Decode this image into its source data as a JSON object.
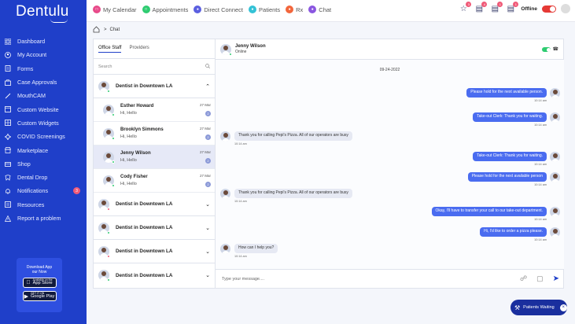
{
  "app": {
    "logo": "Dentulu"
  },
  "sidebar": {
    "items": [
      {
        "label": "Dashboard",
        "icon": "grid-icon"
      },
      {
        "label": "My Account",
        "icon": "user-circle-icon"
      },
      {
        "label": "Forms",
        "icon": "forms-icon"
      },
      {
        "label": "Case Approvals",
        "icon": "briefcase-icon"
      },
      {
        "label": "MouthCAM",
        "icon": "wand-icon"
      },
      {
        "label": "Custom Website",
        "icon": "website-icon"
      },
      {
        "label": "Custom Widgets",
        "icon": "widget-icon"
      },
      {
        "label": "COVID Screenings",
        "icon": "virus-icon"
      },
      {
        "label": "Marketplace",
        "icon": "store-icon"
      },
      {
        "label": "Shop",
        "icon": "shop-icon"
      },
      {
        "label": "Dental Drop",
        "icon": "tooth-icon"
      },
      {
        "label": "Notifications",
        "icon": "bell-icon",
        "badge": "3"
      },
      {
        "label": "Resources",
        "icon": "resources-icon"
      },
      {
        "label": "Report a problem",
        "icon": "warning-icon"
      }
    ],
    "download": {
      "text": "Download App our Now",
      "appstore_small": "Available on the",
      "appstore": "App Store",
      "googleplay_small": "GET IT ON",
      "googleplay": "Google Play"
    }
  },
  "topnav": {
    "items": [
      {
        "label": "My Calendar",
        "color": "#e84a8a"
      },
      {
        "label": "Appointments",
        "color": "#2ecc71"
      },
      {
        "label": "Direct Connect",
        "color": "#5b5fe0"
      },
      {
        "label": "Patients",
        "color": "#33c2d6"
      },
      {
        "label": "Rx",
        "color": "#f2663c"
      },
      {
        "label": "Chat",
        "color": "#8a56e0"
      }
    ],
    "badges": [
      "3",
      "4",
      "1",
      "1"
    ],
    "status": "Offline"
  },
  "breadcrumb": {
    "current": "Chat"
  },
  "chatlist": {
    "tabs": [
      "Office Staff",
      "Providers"
    ],
    "search_placeholder": "Search",
    "groups": [
      {
        "name": "Dentist in Downtown LA",
        "expanded": true
      },
      {
        "name": "Dentist in Downtown LA"
      },
      {
        "name": "Dentist in Downtown LA"
      },
      {
        "name": "Dentist in Downtown LA"
      },
      {
        "name": "Dentist in Downtown LA"
      }
    ],
    "contacts": [
      {
        "name": "Esther Howard",
        "msg": "Hi, Hello",
        "date": "27 Mar",
        "badge": "2"
      },
      {
        "name": "Brooklyn Simmons",
        "msg": "Hi, Hello",
        "date": "27 Mar",
        "badge": "2"
      },
      {
        "name": "Jenny Wilson",
        "msg": "Hi, Hello",
        "date": "27 Mar",
        "badge": "2",
        "selected": true
      },
      {
        "name": "Cody Fisher",
        "msg": "Hi, Hello",
        "date": "27 Mar",
        "badge": "2"
      }
    ]
  },
  "chat": {
    "header": {
      "name": "Jenny Wilson",
      "status": "Online"
    },
    "date": "09-24-2022",
    "messages": [
      {
        "dir": "out",
        "text": "Please hold for the next available person.",
        "time": "10:14 am"
      },
      {
        "dir": "out",
        "text": "Take-out Clerk: Thank you for waiting.",
        "time": "10:14 am"
      },
      {
        "dir": "in",
        "text": "Thank you for calling Pepi's Pizza. All of our operators are busy",
        "time": "10:14 am"
      },
      {
        "dir": "out",
        "text": "Take-out Clerk: Thank you for waiting.",
        "time": "10:14 am"
      },
      {
        "dir": "out",
        "text": "Please hold for the next available person",
        "time": "10:14 am"
      },
      {
        "dir": "in",
        "text": "Thank you for calling Pepi's Pizza. All of our operators are busy",
        "time": "10:14 am"
      },
      {
        "dir": "out",
        "text": "Okay, I'll have to transfer your call to our take-out department.",
        "time": "10:14 am"
      },
      {
        "dir": "out",
        "text": "Hi, I'd like to order a pizza please.",
        "time": "10:14 am"
      },
      {
        "dir": "in",
        "text": "How can I help you?",
        "time": "10:14 am"
      }
    ],
    "input_placeholder": "Type your message...."
  },
  "patients_waiting": {
    "label": "Patients Waiting"
  }
}
